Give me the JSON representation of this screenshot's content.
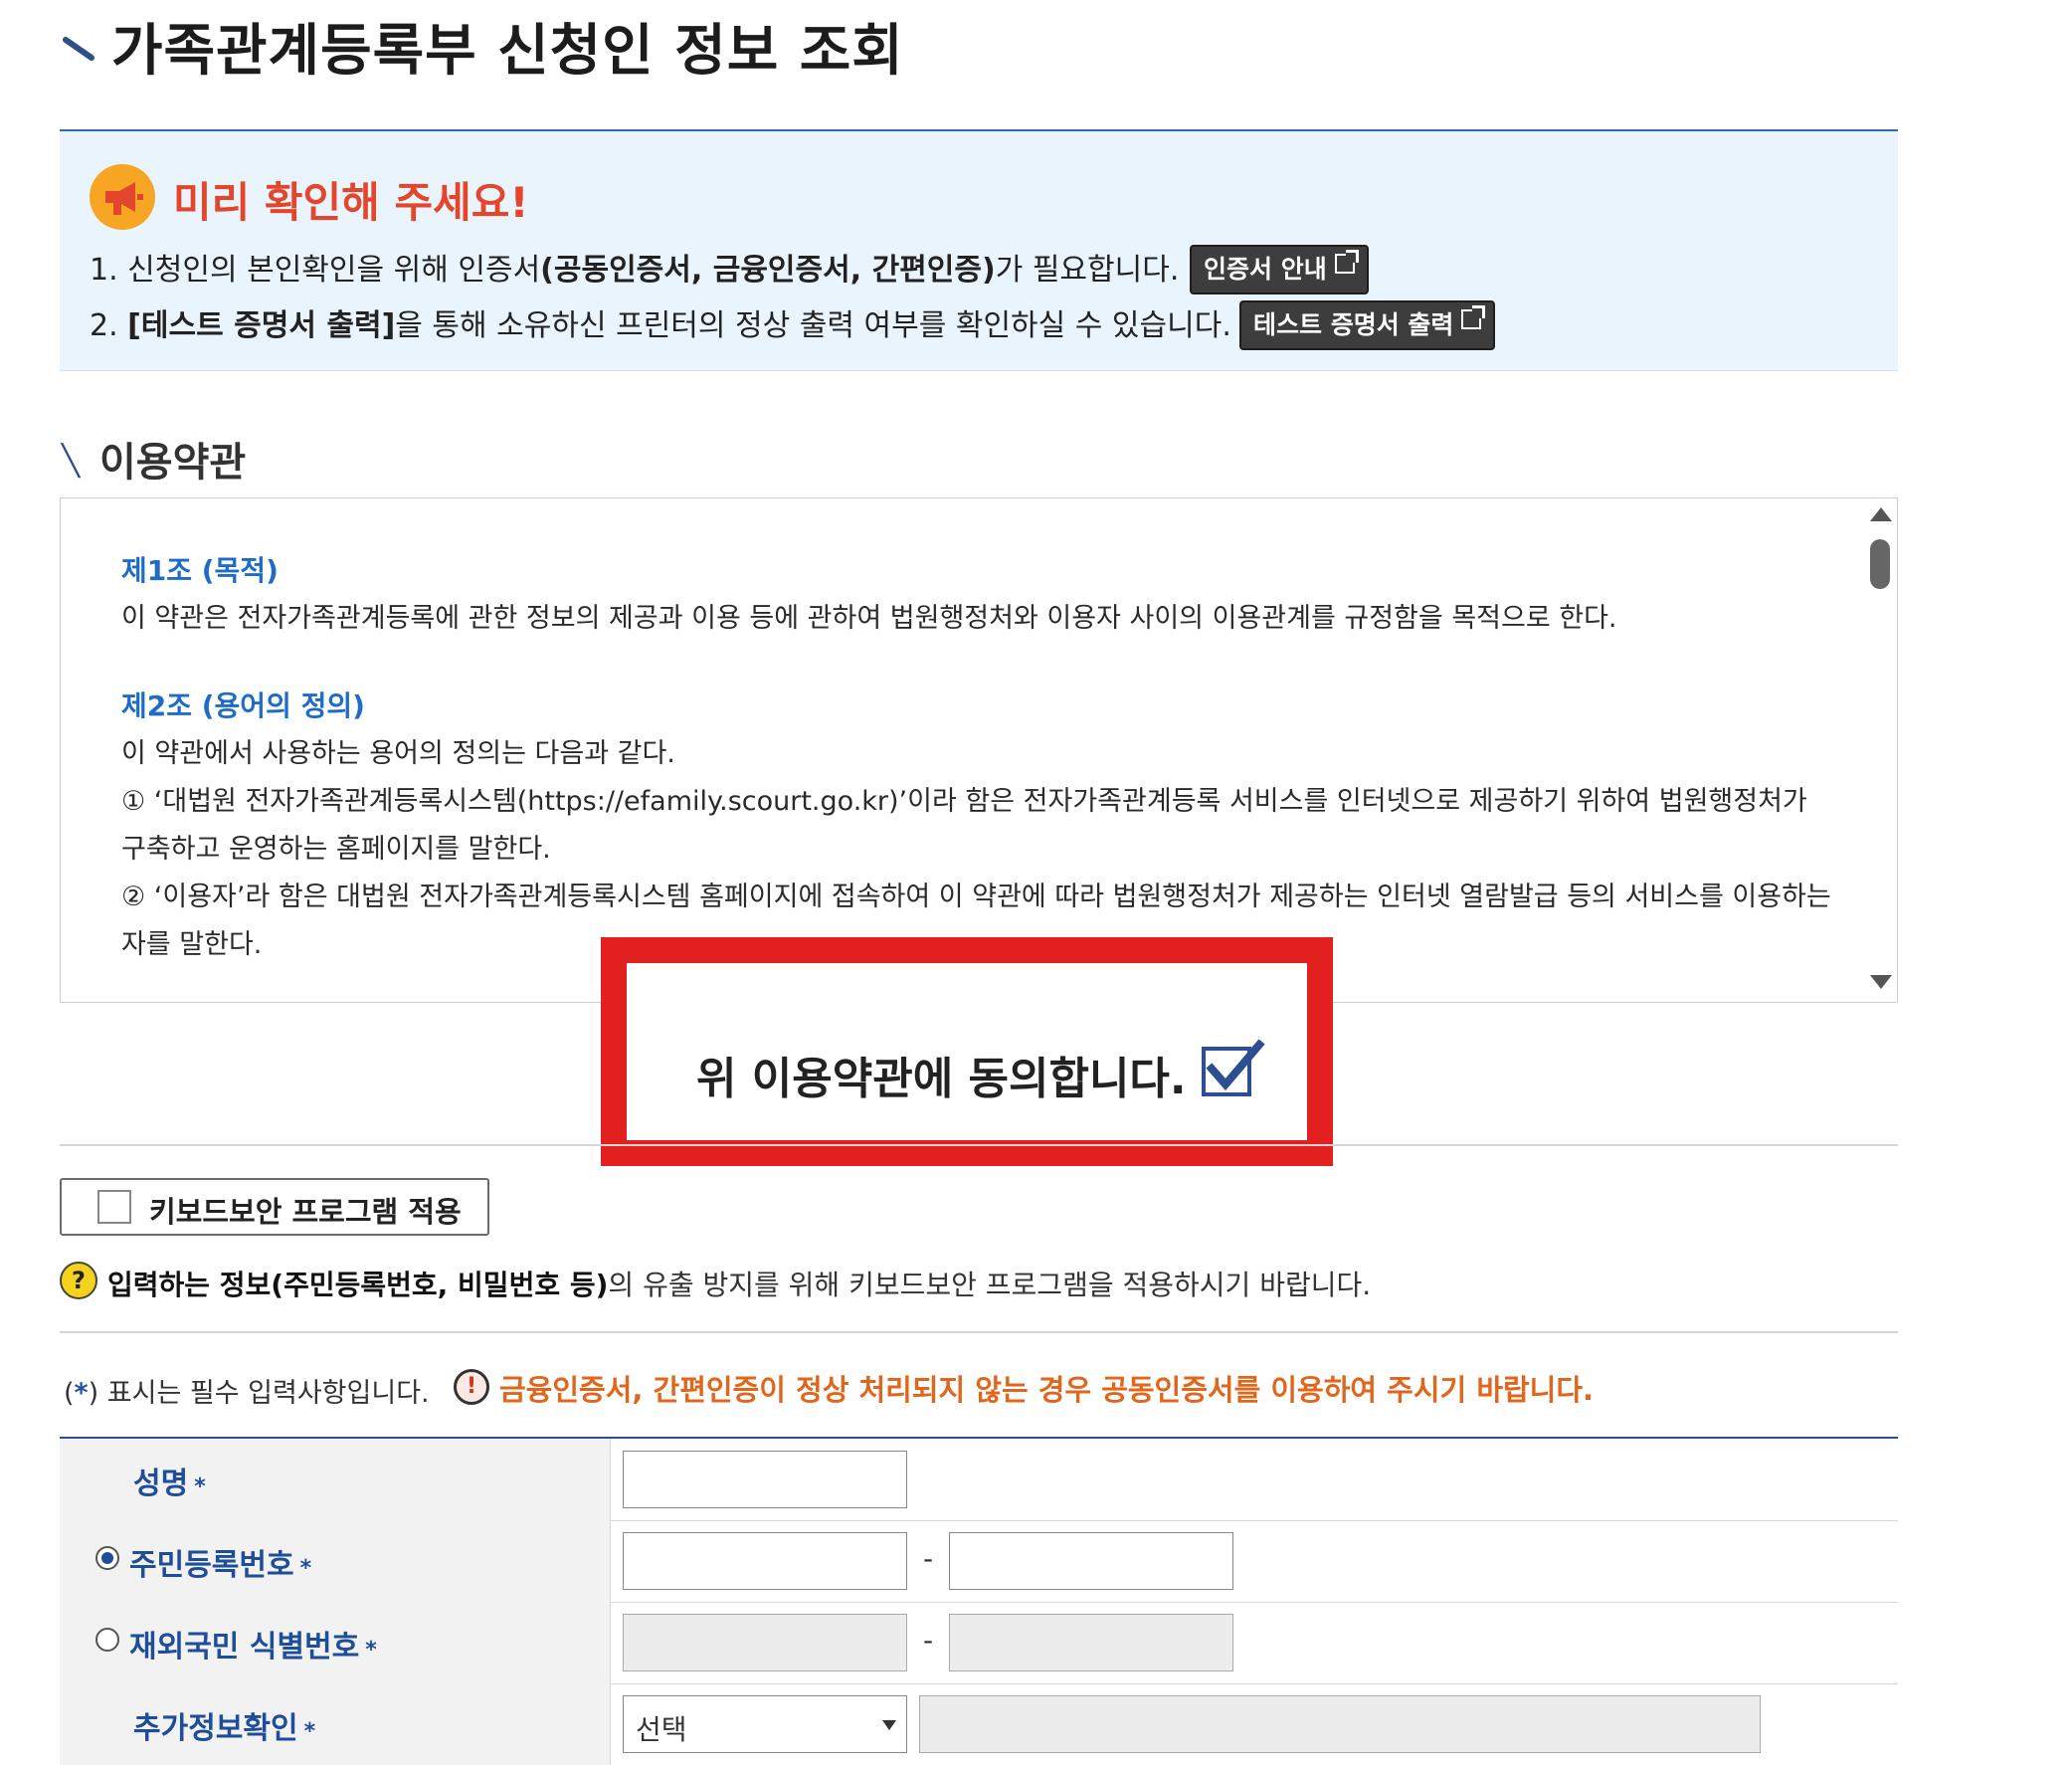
{
  "page": {
    "title": "가족관계등록부 신청인 정보 조회"
  },
  "notice": {
    "title": "미리 확인해 주세요!",
    "line1_prefix": "1. 신청인의 본인확인을 위해 인증서",
    "line1_bold": "(공동인증서, 금융인증서, 간편인증)",
    "line1_suffix": "가 필요합니다.",
    "line1_button": "인증서 안내",
    "line2_prefix": "2. ",
    "line2_bold": "[테스트 증명서 출력]",
    "line2_suffix": "을 통해 소유하신 프린터의 정상 출력 여부를 확인하실 수 있습니다.",
    "line2_button": "테스트 증명서 출력"
  },
  "terms": {
    "section_title": "이용약관",
    "article1_title": "제1조 (목적)",
    "article1_body": "이 약관은 전자가족관계등록에 관한 정보의 제공과 이용 등에 관하여 법원행정처와 이용자 사이의 이용관계를 규정함을 목적으로 한다.",
    "article2_title": "제2조 (용어의 정의)",
    "article2_intro": "이 약관에서 사용하는 용어의 정의는 다음과 같다.",
    "article2_item1": "① ‘대법원 전자가족관계등록시스템(https://efamily.scourt.go.kr)’이라 함은 전자가족관계등록 서비스를 인터넷으로 제공하기 위하여 법원행정처가 구축하고 운영하는 홈페이지를 말한다.",
    "article2_item2": "② ‘이용자’라 함은 대법원 전자가족관계등록시스템 홈페이지에 접속하여 이 약관에 따라 법원행정처가 제공하는 인터넷 열람발급 등의 서비스를 이용하는 자를 말한다.",
    "agree_label": "위 이용약관에 동의합니다.",
    "agree_checked": true
  },
  "keyboard": {
    "button_label": "키보드보안 프로그램 적용",
    "help_bold": "입력하는 정보(주민등록번호, 비밀번호 등)",
    "help_rest": "의 유출 방지를 위해 키보드보안 프로그램을 적용하시기 바랍니다."
  },
  "form": {
    "required_note_open": "(",
    "required_note_star": "*",
    "required_note_rest": ") 표시는 필수 입력사항입니다.",
    "warning": "금융인증서, 간편인증이 정상 처리되지 않는 경우 공동인증서를 이용하여 주시기 바랍니다.",
    "star": "*",
    "dash": "-",
    "name_label": "성명",
    "rrn_label": "주민등록번호",
    "foreign_label": "재외국민 식별번호",
    "extra_label": "추가정보확인",
    "extra_select_value": "선택"
  },
  "colors": {
    "title_accent": "#2d4f8a",
    "notice_bg": "#eaf4fc",
    "notice_title": "#e2462c",
    "article_title": "#1f6cc7",
    "highlight_border": "#e32020",
    "warning_text": "#e2651c",
    "label_text": "#1e4d99"
  },
  "icons": {
    "notice": "megaphone-icon",
    "external": "external-link-icon",
    "help": "question-icon",
    "warning": "exclamation-icon",
    "agree": "checkbox-checked-icon"
  }
}
